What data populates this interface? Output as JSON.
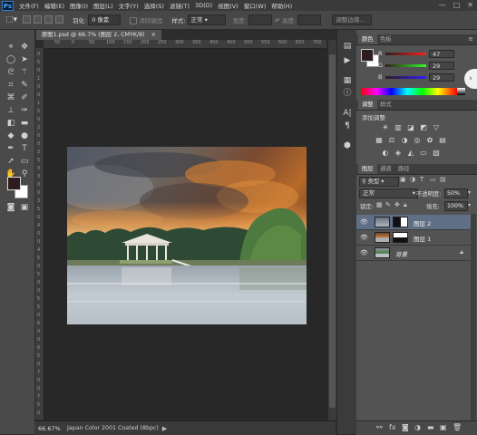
{
  "app": {
    "logo": "Ps"
  },
  "menu": [
    "文件(F)",
    "编辑(E)",
    "图像(I)",
    "图层(L)",
    "文字(Y)",
    "选择(S)",
    "滤镜(T)",
    "3D(D)",
    "视图(V)",
    "窗口(W)",
    "帮助(H)"
  ],
  "window_controls": {
    "minimize": "—",
    "maximize": "□",
    "close": "✕"
  },
  "options": {
    "feather_label": "羽化:",
    "feather_value": "0 像素",
    "antialias_label": "消除锯齿",
    "style_label": "样式:",
    "style_value": "正常",
    "width_label": "宽度:",
    "height_label": "高度:",
    "refine_button": "调整边缘..."
  },
  "document": {
    "tab_title": "原图1.psd @ 66.7% (图层 2, CMYK/8)",
    "tab_close": "×",
    "ruler_top": [
      "50",
      "0",
      "50",
      "100",
      "150",
      "200",
      "250",
      "300",
      "350",
      "400",
      "450",
      "500",
      "550",
      "600",
      "650",
      "700"
    ],
    "ruler_left": [
      "0",
      "5",
      "0",
      "1",
      "0",
      "0",
      "1",
      "5",
      "0",
      "2",
      "0",
      "0",
      "2",
      "5",
      "0",
      "3",
      "0",
      "0",
      "3",
      "5",
      "0",
      "4",
      "0",
      "0",
      "4",
      "5",
      "0",
      "5",
      "0",
      "0",
      "5",
      "5",
      "0",
      "6",
      "0",
      "0",
      "6",
      "5",
      "0",
      "7",
      "0",
      "0",
      "7",
      "5",
      "0"
    ]
  },
  "status": {
    "zoom": "66.67%",
    "info": "Japan Color 2001 Coated (8bpc)"
  },
  "color_panel": {
    "tabs": [
      "颜色",
      "色板"
    ],
    "r_label": "R",
    "r_value": "47",
    "g_label": "G",
    "g_value": "29",
    "b_label": "B",
    "b_value": "29",
    "fg_color": "#2f1d1d"
  },
  "adjust_panel": {
    "tabs": [
      "调整",
      "样式"
    ],
    "add_label": "添加调整"
  },
  "layers_panel": {
    "tabs": [
      "图层",
      "通道",
      "路径"
    ],
    "filter_type": "类型",
    "blend_mode": "正常",
    "opacity_label": "不透明度:",
    "opacity_value": "50%",
    "lock_label": "锁定:",
    "fill_label": "填充:",
    "fill_value": "100%",
    "layers": [
      {
        "name": "图层 2",
        "selected": true
      },
      {
        "name": "图层 1",
        "selected": false
      },
      {
        "name": "背景",
        "selected": false
      }
    ]
  }
}
